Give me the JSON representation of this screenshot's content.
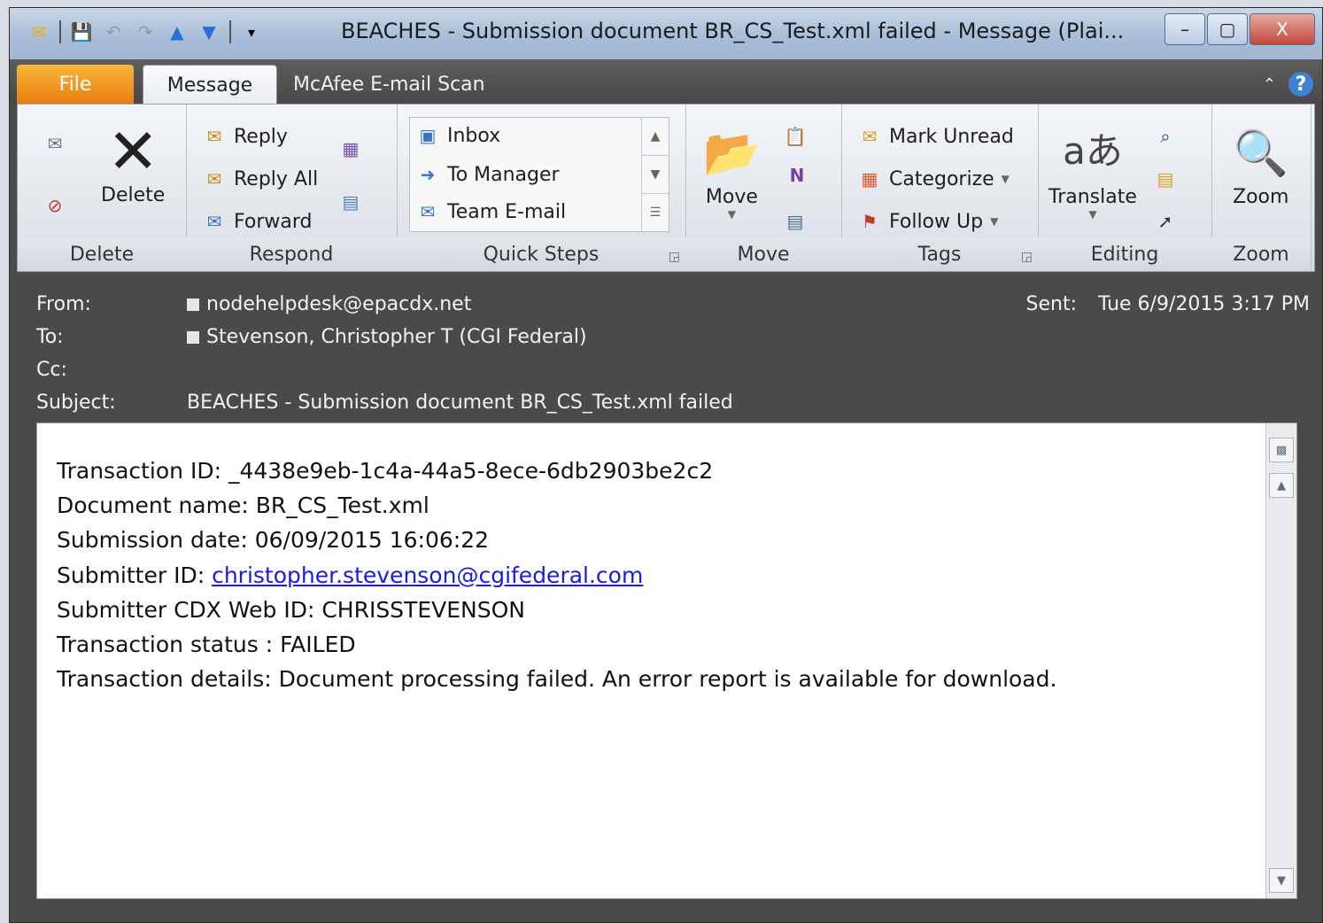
{
  "window": {
    "title": "BEACHES - Submission document BR_CS_Test.xml failed  -  Message (Plai...",
    "controls": {
      "minimize": "–",
      "maximize": "▢",
      "close": "X"
    }
  },
  "tabs": [
    {
      "label": "File"
    },
    {
      "label": "Message"
    },
    {
      "label": "McAfee E-mail Scan"
    }
  ],
  "ribbon": {
    "delete_group": {
      "label": "Delete",
      "delete_button": "Delete"
    },
    "respond_group": {
      "label": "Respond",
      "reply": "Reply",
      "reply_all": "Reply All",
      "forward": "Forward"
    },
    "quick_steps_group": {
      "label": "Quick Steps",
      "items": [
        "Inbox",
        "To Manager",
        "Team E-mail"
      ]
    },
    "move_group": {
      "label": "Move",
      "move_button": "Move"
    },
    "tags_group": {
      "label": "Tags",
      "mark_unread": "Mark Unread",
      "categorize": "Categorize",
      "follow_up": "Follow Up"
    },
    "editing_group": {
      "label": "Editing",
      "translate": "Translate"
    },
    "zoom_group": {
      "label": "Zoom",
      "zoom_button": "Zoom"
    }
  },
  "header": {
    "from_label": "From:",
    "from_value": "nodehelpdesk@epacdx.net",
    "to_label": "To:",
    "to_value": "Stevenson, Christopher T (CGI Federal)",
    "cc_label": "Cc:",
    "subject_label": "Subject:",
    "subject_value": "BEACHES - Submission document BR_CS_Test.xml failed",
    "sent_label": "Sent:",
    "sent_value": "Tue 6/9/2015 3:17 PM"
  },
  "body": {
    "transaction_id": "Transaction ID: _4438e9eb-1c4a-44a5-8ece-6db2903be2c2",
    "document_name": "Document name: BR_CS_Test.xml",
    "submission_date": "Submission date: 06/09/2015 16:06:22",
    "submitter_id_label": "Submitter ID: ",
    "submitter_id_link": "christopher.stevenson@cgifederal.com",
    "cdx_web_id": "Submitter CDX Web ID: CHRISSTEVENSON",
    "status": "Transaction status : FAILED",
    "details": "Transaction details: Document processing failed. An error report is available for download."
  },
  "colors": {
    "link": "#1a1ae6",
    "file_tab": "#e87d0f",
    "chrome_dark": "#4a4a4a"
  }
}
